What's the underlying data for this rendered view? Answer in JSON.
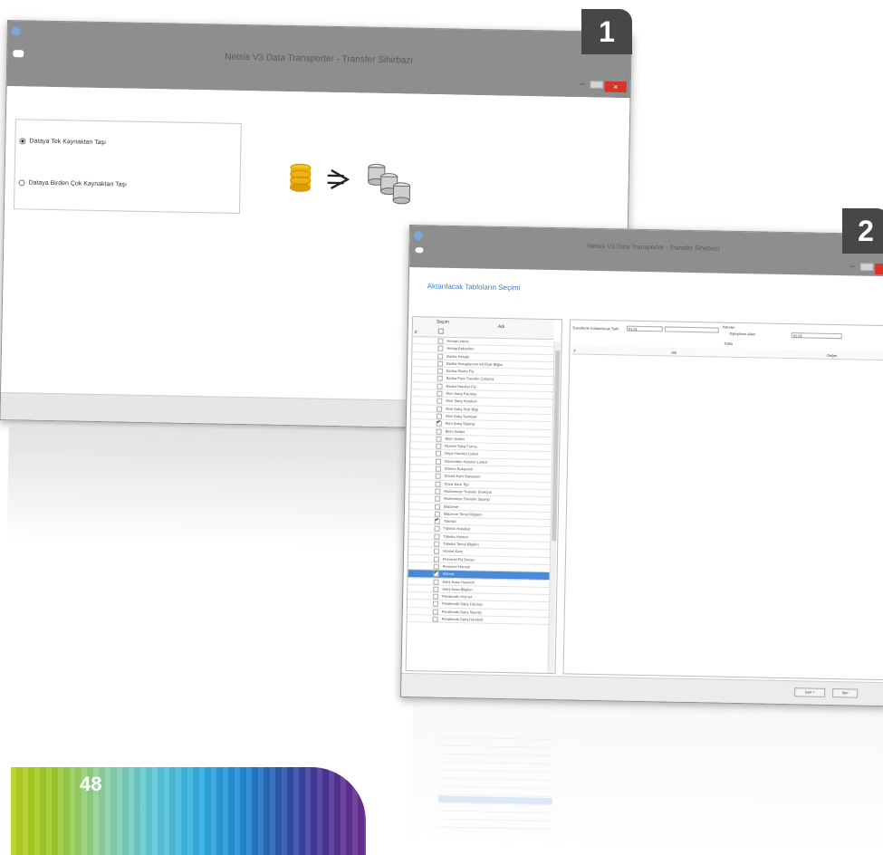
{
  "window1": {
    "title": "Netsis V3 Data Transporter - Transfer Sihirbazı",
    "minimize": "–",
    "close": "×",
    "options": [
      {
        "label": "Dataya Tek Kaynaktan Taşı",
        "selected": true
      },
      {
        "label": "Dataya Birden Çok Kaynaktan Taşı",
        "selected": false
      }
    ]
  },
  "badges": {
    "first": "1",
    "second": "2"
  },
  "window2": {
    "title": "Netsis V3 Data Transporter - Transfer Sihirbazı",
    "minimize": "–",
    "close": "×",
    "section_title": "Aktarılacak Tabloların Seçimi",
    "table_headers": {
      "selection": "Seçim",
      "name": "Adı",
      "hash": "#"
    },
    "tables": [
      {
        "name": "Hesap Listesi",
        "checked": false
      },
      {
        "name": "Hesap Bakiyeleri",
        "checked": false
      },
      {
        "name": "Banka Hesabı",
        "checked": false
      },
      {
        "name": "Banka Hesaplarının Alt Fiyat Bilgisi",
        "checked": false
      },
      {
        "name": "Banka Ekstre Fiş",
        "checked": false
      },
      {
        "name": "Banka Para Transfer Çalışma",
        "checked": false
      },
      {
        "name": "Banka Hareket Fiş",
        "checked": false
      },
      {
        "name": "Alım Satış Faturası",
        "checked": false
      },
      {
        "name": "Alım Satış Hareketi",
        "checked": false
      },
      {
        "name": "Alım Satış Stok Bilgi",
        "checked": false
      },
      {
        "name": "Alım Satış Sevkiyat",
        "checked": false
      },
      {
        "name": "Alım Satış Siparişi",
        "checked": true
      },
      {
        "name": "Birim Setleri",
        "checked": false
      },
      {
        "name": "Birim Setleri",
        "checked": false
      },
      {
        "name": "Hizmet Takip Formu",
        "checked": false
      },
      {
        "name": "Depo Hareket Listesi",
        "checked": false
      },
      {
        "name": "Dönemden Hareket Listesi",
        "checked": false
      },
      {
        "name": "Dönem Bakiyeleri",
        "checked": false
      },
      {
        "name": "Dövizli Kartı Bakiyeleri",
        "checked": false
      },
      {
        "name": "Döviz Kartı Tipi",
        "checked": false
      },
      {
        "name": "Malzemeye Transfer Sevkiyat",
        "checked": false
      },
      {
        "name": "Malzemeye Transfer Siparişi",
        "checked": false
      },
      {
        "name": "Malzeme",
        "checked": false
      },
      {
        "name": "Malzeme Temel Bilgileri",
        "checked": false
      },
      {
        "name": "Tüketici",
        "checked": true
      },
      {
        "name": "Tüketici Hareketi",
        "checked": false
      },
      {
        "name": "Tüketici Hizmet",
        "checked": false
      },
      {
        "name": "Tüketici Temel Bilgileri",
        "checked": false
      },
      {
        "name": "Hizmet Kartı",
        "checked": false
      },
      {
        "name": "Personel Fiş Detayı",
        "checked": false
      },
      {
        "name": "Personel Hizmeti",
        "checked": false
      },
      {
        "name": "Hizmet",
        "checked": true,
        "selected": true
      },
      {
        "name": "Satış Kasa Hareketi",
        "checked": false
      },
      {
        "name": "Satış Kasa Bilgileri",
        "checked": false
      },
      {
        "name": "Perakende Hizmet",
        "checked": false
      },
      {
        "name": "Perakende Satış Faturası",
        "checked": false
      },
      {
        "name": "Perakende Satış Siparişi",
        "checked": false
      },
      {
        "name": "Perakende Satış Hareketi",
        "checked": false
      }
    ],
    "right_panel": {
      "transfer_label": "Transferde Kullanılacak Tarih",
      "transfer_value": "01.01",
      "filter_label": "Filtreler",
      "match_label": "Eşleştirme Alanı",
      "match_value": "01.01",
      "table_label": "Tablo",
      "grid_headers": {
        "hash": "#",
        "name": "Adı",
        "value": "Değer"
      }
    },
    "buttons": {
      "back": "Geri <",
      "next": "İleri"
    }
  },
  "page_number": "48",
  "colors": {
    "titlebar": "#8e8e8e",
    "close": "#d9342b",
    "accent": "#3e7cc0",
    "selected_row": "#4b8ad6",
    "badge": "#474747"
  }
}
